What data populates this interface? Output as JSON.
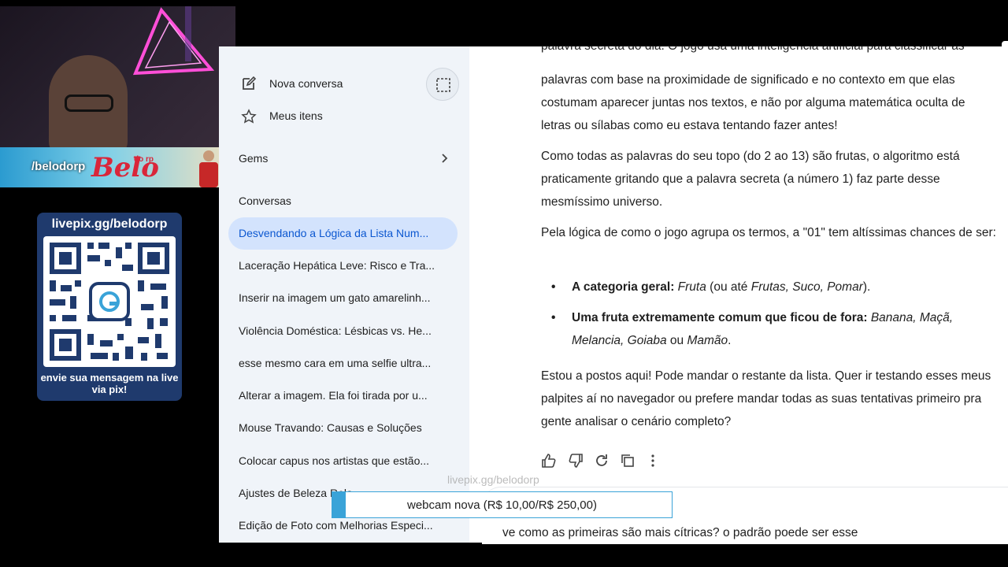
{
  "stream": {
    "handle": "/belodorp",
    "logo": "Belo",
    "logo_sub": "do rp",
    "pix_url": "livepix.gg/belodorp",
    "pix_message": "envie sua mensagem na live via pix!",
    "watermark": "livepix.gg/belodorp",
    "goal_text": "webcam nova (R$ 10,00/R$ 250,00)",
    "goal_progress": 0.04
  },
  "sidebar": {
    "new_chat": "Nova conversa",
    "my_items": "Meus itens",
    "gems": "Gems",
    "conversations_header": "Conversas",
    "conversations": [
      "Desvendando a Lógica da Lista Num...",
      "Laceração Hepática Leve: Risco e Tra...",
      "Inserir na imagem um gato amarelinh...",
      "Violência Doméstica: Lésbicas vs. He...",
      "esse mesmo cara em uma selfie ultra...",
      "Alterar a imagem. Ela foi tirada por u...",
      "Mouse Travando: Causas e Soluções",
      "Colocar capus nos artistas que estão...",
      "Ajustes de Beleza Rela...",
      "Edição de Foto com Melhorias Especi..."
    ],
    "active_index": 0
  },
  "chat": {
    "para1_lines": [
      "palavra secreta do dia. O jogo usa uma inteligência artificial para classificar as",
      "palavras com base na proximidade de significado e no contexto em que elas",
      "costumam aparecer juntas nos textos, e não por alguma matemática oculta de",
      "letras ou sílabas como eu estava tentando fazer antes!"
    ],
    "para2": "Como todas as palavras do seu topo (do 2 ao 13) são frutas, o algoritmo está praticamente gritando que a palavra secreta (a número 1) faz parte desse mesmíssimo universo.",
    "para3": "Pela lógica de como o jogo agrupa os termos, a \"01\" tem altíssimas chances de ser:",
    "bullet1_bold": "A categoria geral:",
    "bullet1_italic": "Fruta",
    "bullet1_rest": " (ou até ",
    "bullet1_italic2": "Frutas, Suco, Pomar",
    "bullet1_end": ").",
    "bullet2_bold": "Uma fruta extremamente comum que ficou de fora:",
    "bullet2_italic": "Banana, Maçã, Melancia, Goiaba",
    "bullet2_mid": " ou ",
    "bullet2_italic2": "Mamão",
    "bullet2_end": ".",
    "para4": "Estou a postos aqui! Pode mandar o restante da lista. Quer ir testando esses meus palpites aí no navegador ou prefere mandar todas as suas tentativas primeiro pra gente analisar o cenário completo?",
    "composer_text": "ve como as primeiras são mais cítricas? o padrão poede ser esse"
  },
  "icons": {
    "new_chat": "edit-icon",
    "my_items": "gem-star-icon",
    "toggle": "sidebar-toggle-icon",
    "actions": [
      "thumbs-up-icon",
      "thumbs-down-icon",
      "regenerate-icon",
      "copy-icon",
      "more-icon"
    ]
  }
}
